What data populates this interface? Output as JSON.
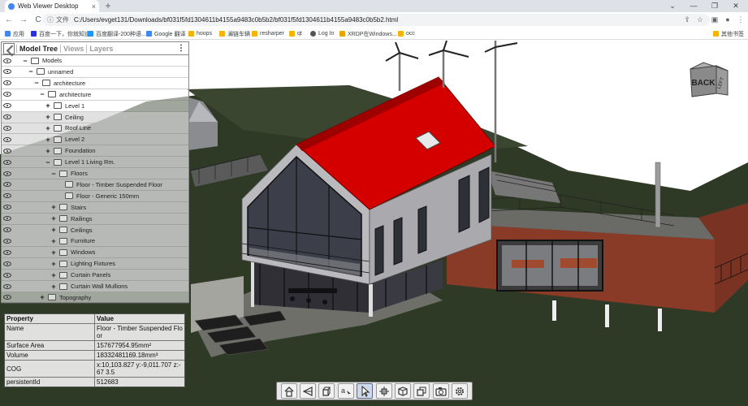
{
  "browser": {
    "tab_title": "Web Viewer Desktop",
    "tab_close": "×",
    "new_tab": "+",
    "window_controls": [
      "⌄",
      "—",
      "❐",
      "✕"
    ],
    "nav": {
      "back": "←",
      "forward": "→",
      "reload": "C"
    },
    "address": {
      "info": "ⓘ",
      "scheme": "文件",
      "url": "C:/Users/evget131/Downloads/bf031f5fd1304611b4155a9483c0b5b2/bf031f5fd1304611b4155a9483c0b5b2.html"
    },
    "toolbar_icons": [
      "share-icon",
      "star-icon",
      "extensions-icon",
      "sidebar-icon",
      "profile-icon",
      "menu-icon"
    ],
    "bookmarks": [
      {
        "label": "应用",
        "color": "#4285f4"
      },
      {
        "label": "百度一下，你就知道",
        "color": "#2932e1"
      },
      {
        "label": "百度翻译-200种语...",
        "color": "#2196f3"
      },
      {
        "label": "Google 翻译",
        "color": "#4285f4"
      },
      {
        "label": "hoops",
        "color": "#f4b400"
      },
      {
        "label": "澜链车辆",
        "color": "#f4b400"
      },
      {
        "label": "resharper",
        "color": "#f4b400"
      },
      {
        "label": "qt",
        "color": "#f4b400"
      },
      {
        "label": "Log In",
        "color": "#555555"
      },
      {
        "label": "XRDP在Windows...",
        "color": "#e6a700"
      },
      {
        "label": "occ",
        "color": "#f4b400"
      }
    ],
    "other_bookmarks": "其他书签"
  },
  "tree": {
    "tabs": [
      "Model Tree",
      "Views",
      "Layers"
    ],
    "active_tab": "Model Tree",
    "menu": "⋮",
    "rows": [
      {
        "label": "Models",
        "depth": 0,
        "toggle": "−",
        "selected": false
      },
      {
        "label": "unnamed",
        "depth": 1,
        "toggle": "−",
        "selected": false
      },
      {
        "label": "architecture",
        "depth": 2,
        "toggle": "−",
        "selected": false
      },
      {
        "label": "architecture",
        "depth": 3,
        "toggle": "−",
        "selected": false
      },
      {
        "label": "Level 1",
        "depth": 4,
        "toggle": "+",
        "selected": false
      },
      {
        "label": "Ceiling",
        "depth": 4,
        "toggle": "+",
        "selected": true
      },
      {
        "label": "Roof Line",
        "depth": 4,
        "toggle": "+",
        "selected": true
      },
      {
        "label": "Level 2",
        "depth": 4,
        "toggle": "+",
        "selected": true
      },
      {
        "label": "Foundation",
        "depth": 4,
        "toggle": "+",
        "selected": true
      },
      {
        "label": "Level 1 Living Rm.",
        "depth": 4,
        "toggle": "−",
        "selected": true
      },
      {
        "label": "Floors",
        "depth": 5,
        "toggle": "−",
        "selected": true
      },
      {
        "label": "Floor - Timber Suspended Floor",
        "depth": 6,
        "toggle": "",
        "selected": true
      },
      {
        "label": "Floor - Generic 150mm",
        "depth": 6,
        "toggle": "",
        "selected": true
      },
      {
        "label": "Stairs",
        "depth": 5,
        "toggle": "+",
        "selected": true
      },
      {
        "label": "Railings",
        "depth": 5,
        "toggle": "+",
        "selected": true
      },
      {
        "label": "Ceilings",
        "depth": 5,
        "toggle": "+",
        "selected": true
      },
      {
        "label": "Furniture",
        "depth": 5,
        "toggle": "+",
        "selected": true
      },
      {
        "label": "Windows",
        "depth": 5,
        "toggle": "+",
        "selected": true
      },
      {
        "label": "Lighting Fixtures",
        "depth": 5,
        "toggle": "+",
        "selected": true
      },
      {
        "label": "Curtain Panels",
        "depth": 5,
        "toggle": "+",
        "selected": true
      },
      {
        "label": "Curtain Wall Mullions",
        "depth": 5,
        "toggle": "+",
        "selected": true
      },
      {
        "label": "Topography",
        "depth": 3,
        "toggle": "+",
        "selected": false
      }
    ]
  },
  "properties": {
    "header": [
      "Property",
      "Value"
    ],
    "rows": [
      [
        "Name",
        "Floor - Timber Suspended Floor"
      ],
      [
        "Surface Area",
        "157677954.95mm²"
      ],
      [
        "Volume",
        "18332481169.18mm³"
      ],
      [
        "COG",
        "x:10,103.827 y:-9,011.707 z:-67 3.5"
      ],
      [
        "persistentId",
        "512683"
      ]
    ]
  },
  "navcube": {
    "face_front": "BACK",
    "face_side": "LEFT"
  },
  "tools": [
    {
      "name": "home-icon",
      "active": false
    },
    {
      "name": "camera-orbit-icon",
      "active": false
    },
    {
      "name": "wireframe-cube-icon",
      "active": false
    },
    {
      "name": "annotation-icon",
      "active": false
    },
    {
      "name": "select-pointer-icon",
      "active": true
    },
    {
      "name": "explode-icon",
      "active": false
    },
    {
      "name": "model-browser-icon",
      "active": false
    },
    {
      "name": "cutting-plane-icon",
      "active": false
    },
    {
      "name": "snapshot-camera-icon",
      "active": false
    },
    {
      "name": "settings-gear-icon",
      "active": false
    }
  ],
  "colors": {
    "roof": "#d40000",
    "ground": "#2f3a26",
    "walls": "#b9b9be",
    "terrace": "#8a3b28",
    "sky": "#ffffff"
  }
}
